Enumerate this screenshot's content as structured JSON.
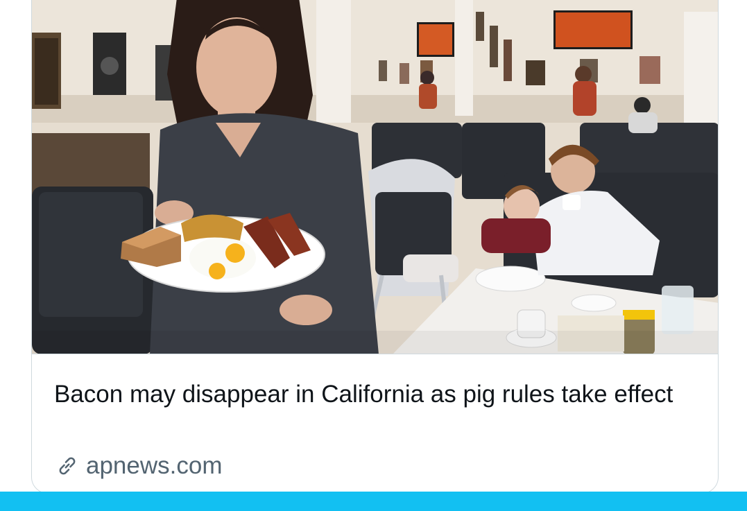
{
  "card": {
    "title": "Bacon may disappear in California as pig rules take effect",
    "domain": "apnews.com",
    "link_icon": "link-icon",
    "image_alt": "Restaurant server holding a plate of bacon, eggs, toast and potatoes in a diner"
  },
  "colors": {
    "title": "#0f1419",
    "domain": "#536471",
    "border": "#cfd9de",
    "bottom_bar": "#12c0f2"
  }
}
